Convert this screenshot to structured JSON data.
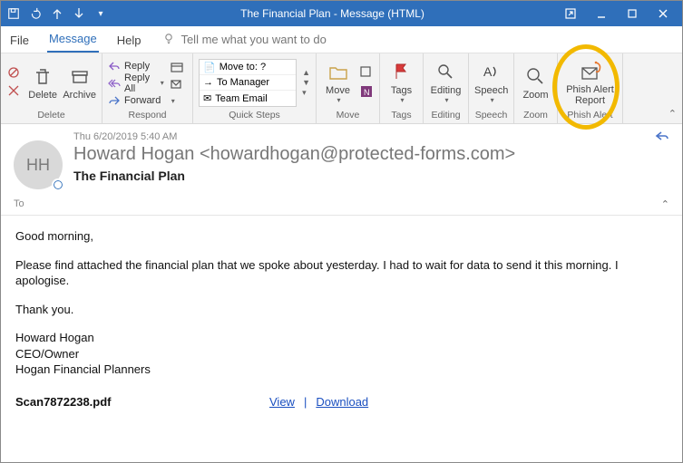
{
  "title": "The Financial Plan  -  Message (HTML)",
  "tabs": {
    "file": "File",
    "message": "Message",
    "help": "Help",
    "tellme": "Tell me what you want to do"
  },
  "ribbon": {
    "delete_group": "Delete",
    "delete": "Delete",
    "archive": "Archive",
    "respond_group": "Respond",
    "reply": "Reply",
    "replyall": "Reply All",
    "forward": "Forward",
    "quicksteps_group": "Quick Steps",
    "qs_moveto": "Move to: ?",
    "qs_tomgr": "To Manager",
    "qs_team": "Team Email",
    "move_group": "Move",
    "move": "Move",
    "tags_group": "Tags",
    "tags": "Tags",
    "editing_group": "Editing",
    "editing": "Editing",
    "speech_group": "Speech",
    "speech": "Speech",
    "zoom_group": "Zoom",
    "zoom": "Zoom",
    "phish_group": "Phish Alert",
    "phish_line1": "Phish Alert",
    "phish_line2": "Report"
  },
  "message": {
    "date": "Thu 6/20/2019 5:40 AM",
    "from": "Howard Hogan <howardhogan@protected-forms.com>",
    "initials": "HH",
    "subject": "The Financial Plan",
    "to_label": "To",
    "body": {
      "greeting": "Good morning,",
      "p1": "Please find attached the financial plan that we spoke about yesterday. I had to wait for data to send it this morning. I apologise.",
      "thanks": "Thank you.",
      "sig1": "Howard Hogan",
      "sig2": "CEO/Owner",
      "sig3": "Hogan Financial Planners"
    },
    "attachment": {
      "name": "Scan7872238.pdf",
      "view": "View",
      "sep": "|",
      "download": "Download"
    }
  }
}
